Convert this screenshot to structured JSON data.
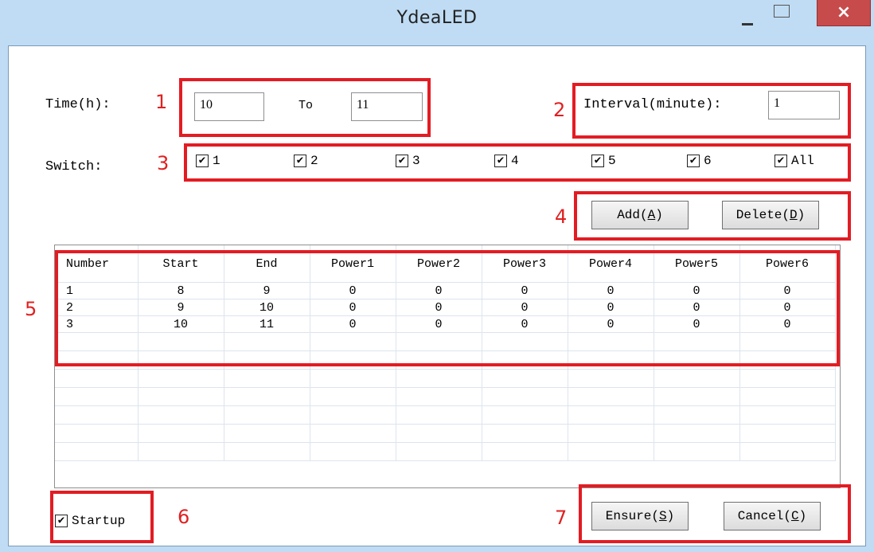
{
  "window": {
    "title": "YdeaLED",
    "minimize": "–",
    "close": "×"
  },
  "annotations": [
    "1",
    "2",
    "3",
    "4",
    "5",
    "6",
    "7"
  ],
  "time": {
    "label": "Time(h):",
    "from": "10",
    "to_label": "To",
    "to": "11"
  },
  "interval": {
    "label": "Interval(minute):",
    "value": "1"
  },
  "switch": {
    "label": "Switch:",
    "items": [
      {
        "label": "1",
        "checked": true
      },
      {
        "label": "2",
        "checked": true
      },
      {
        "label": "3",
        "checked": true
      },
      {
        "label": "4",
        "checked": true
      },
      {
        "label": "5",
        "checked": true
      },
      {
        "label": "6",
        "checked": true
      },
      {
        "label": "All",
        "checked": true
      }
    ]
  },
  "buttons": {
    "add_pre": "Add(",
    "add_key": "A",
    "add_post": ")",
    "delete_pre": "Delete(",
    "delete_key": "D",
    "delete_post": ")",
    "ensure_pre": "Ensure(",
    "ensure_key": "S",
    "ensure_post": ")",
    "cancel_pre": "Cancel(",
    "cancel_key": "C",
    "cancel_post": ")"
  },
  "table": {
    "columns": [
      "Number",
      "Start",
      "End",
      "Power1",
      "Power2",
      "Power3",
      "Power4",
      "Power5",
      "Power6"
    ],
    "rows": [
      [
        "1",
        "8",
        "9",
        "0",
        "0",
        "0",
        "0",
        "0",
        "0"
      ],
      [
        "2",
        "9",
        "10",
        "0",
        "0",
        "0",
        "0",
        "0",
        "0"
      ],
      [
        "3",
        "10",
        "11",
        "0",
        "0",
        "0",
        "0",
        "0",
        "0"
      ]
    ]
  },
  "startup": {
    "label": "Startup",
    "checked": true
  },
  "colors": {
    "annotation": "#e31c23",
    "titlebar": "#bfdcf4",
    "close": "#c74b4b"
  }
}
